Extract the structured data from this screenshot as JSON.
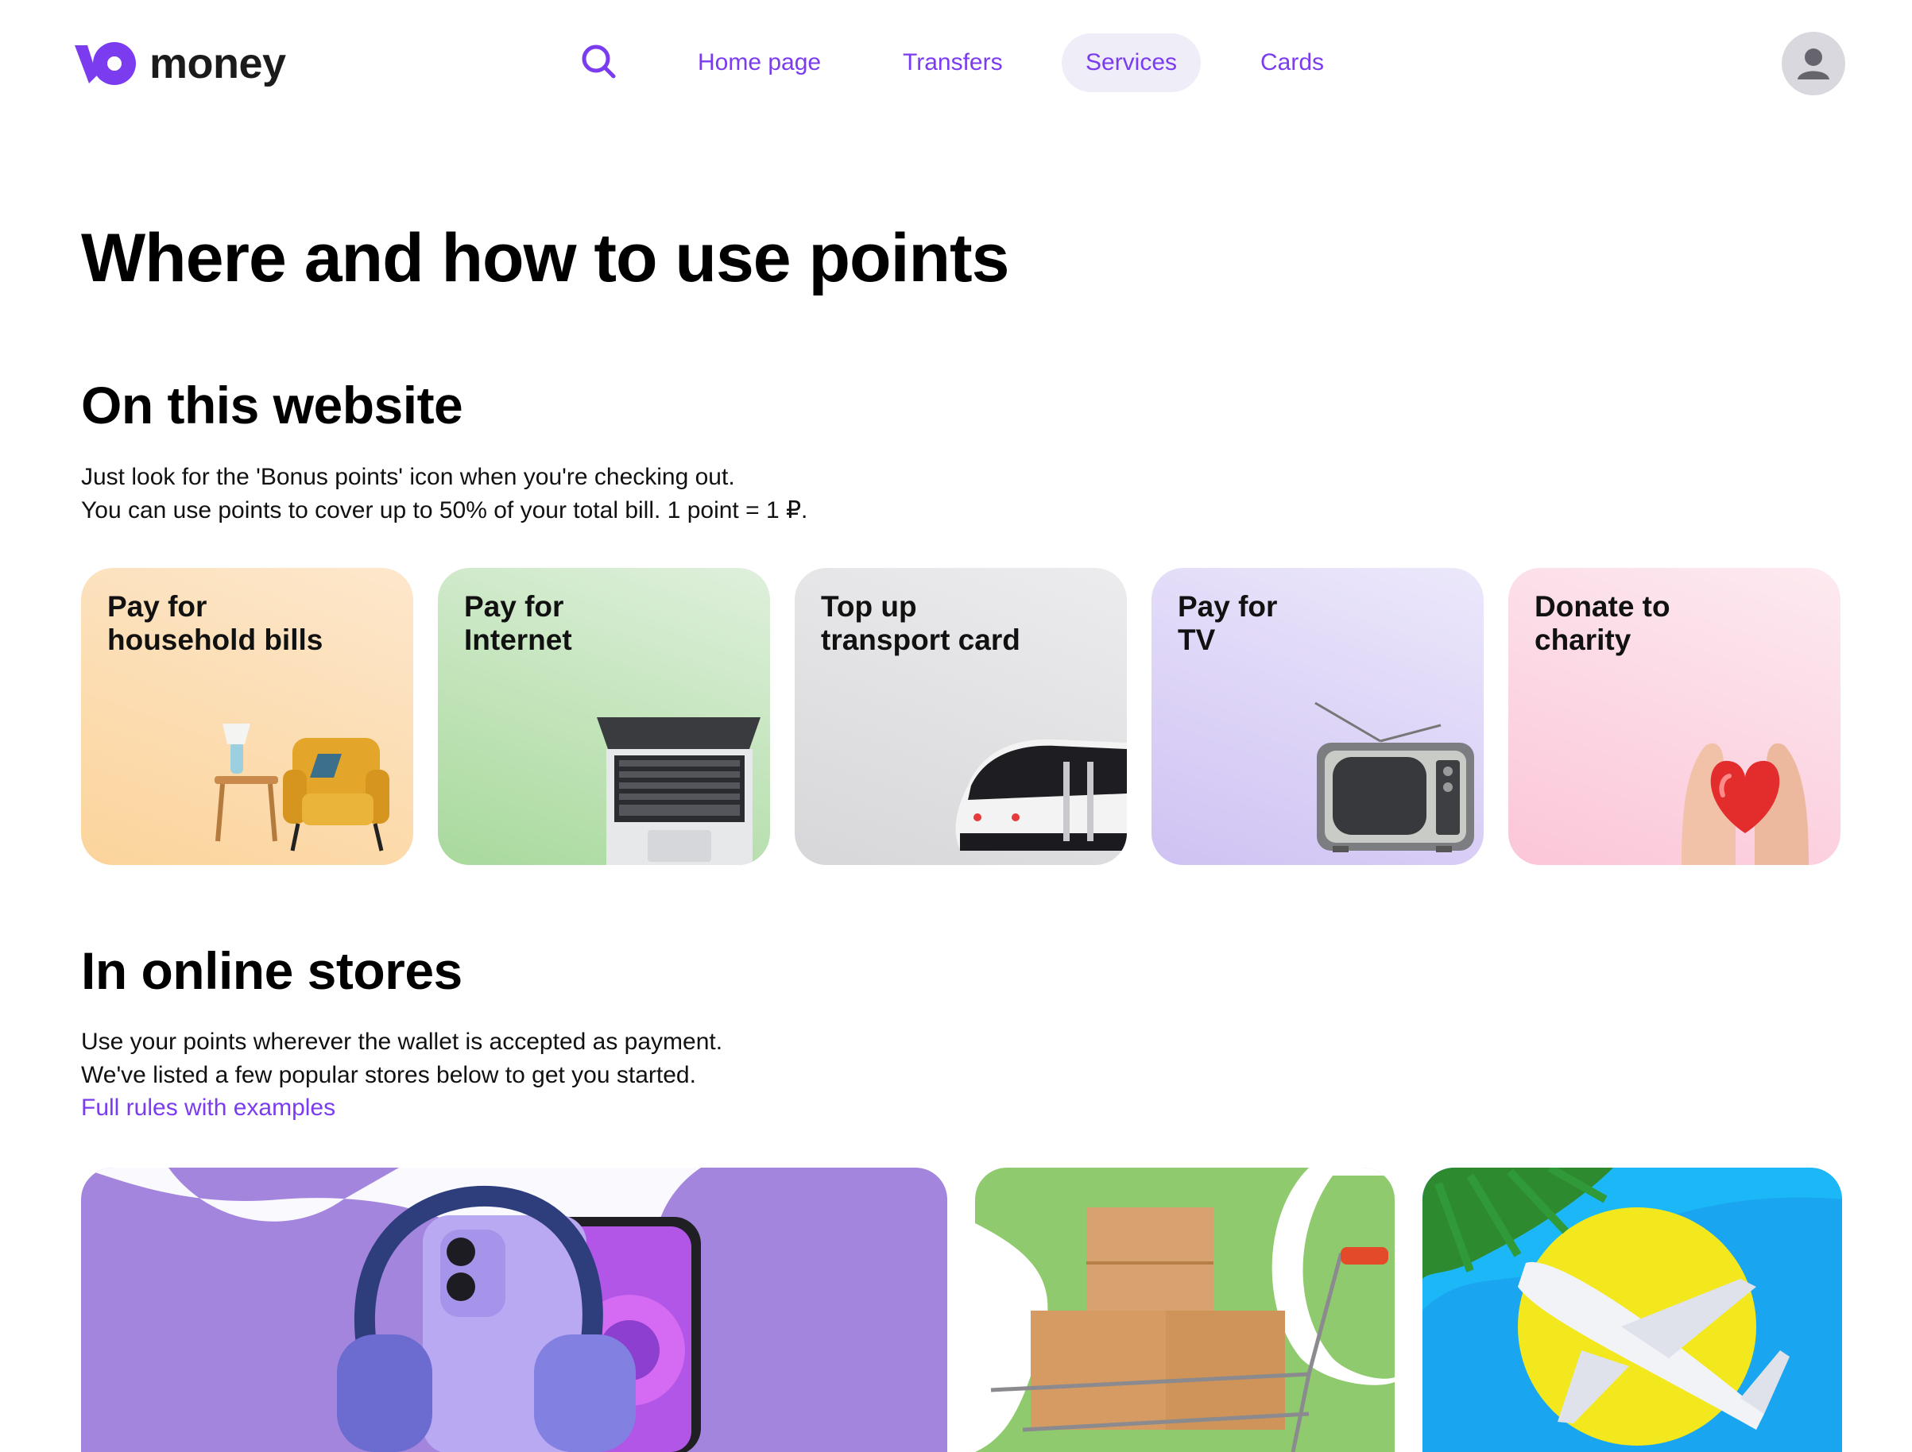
{
  "header": {
    "logo_text": "money",
    "nav": [
      {
        "label": "Home page"
      },
      {
        "label": "Transfers"
      },
      {
        "label": "Services",
        "active": true
      },
      {
        "label": "Cards"
      }
    ]
  },
  "page_title": "Where and how to use points",
  "website_section": {
    "heading": "On this website",
    "lines": [
      "Just look for the 'Bonus points' icon when you're checking out.",
      "You can use points to cover up to 50% of your total bill. 1 point = 1 ₽."
    ],
    "cards": [
      {
        "line1": "Pay for",
        "line2": "household bills",
        "icon": "armchair-icon"
      },
      {
        "line1": "Pay for",
        "line2": "Internet",
        "icon": "laptop-icon"
      },
      {
        "line1": "Top up",
        "line2": "transport card",
        "icon": "tram-icon"
      },
      {
        "line1": "Pay for",
        "line2": "TV",
        "icon": "tv-icon"
      },
      {
        "line1": "Donate to",
        "line2": "charity",
        "icon": "heart-hands-icon"
      }
    ]
  },
  "stores_section": {
    "heading": "In online stores",
    "lines": [
      "Use your points wherever the wallet is accepted as payment.",
      "We've listed a few popular stores below to get you started."
    ],
    "link": "Full rules with examples",
    "stores": [
      {
        "icon": "phone-headphones-icon"
      },
      {
        "icon": "boxes-cart-icon"
      },
      {
        "icon": "airplane-icon"
      }
    ]
  },
  "colors": {
    "accent": "#7b3cf0",
    "card_bills": "#fde4c3",
    "card_internet": "#cde8c8",
    "card_transport": "#e6e6e8",
    "card_tv": "#e4dcf8",
    "card_charity": "#fcdce6"
  }
}
